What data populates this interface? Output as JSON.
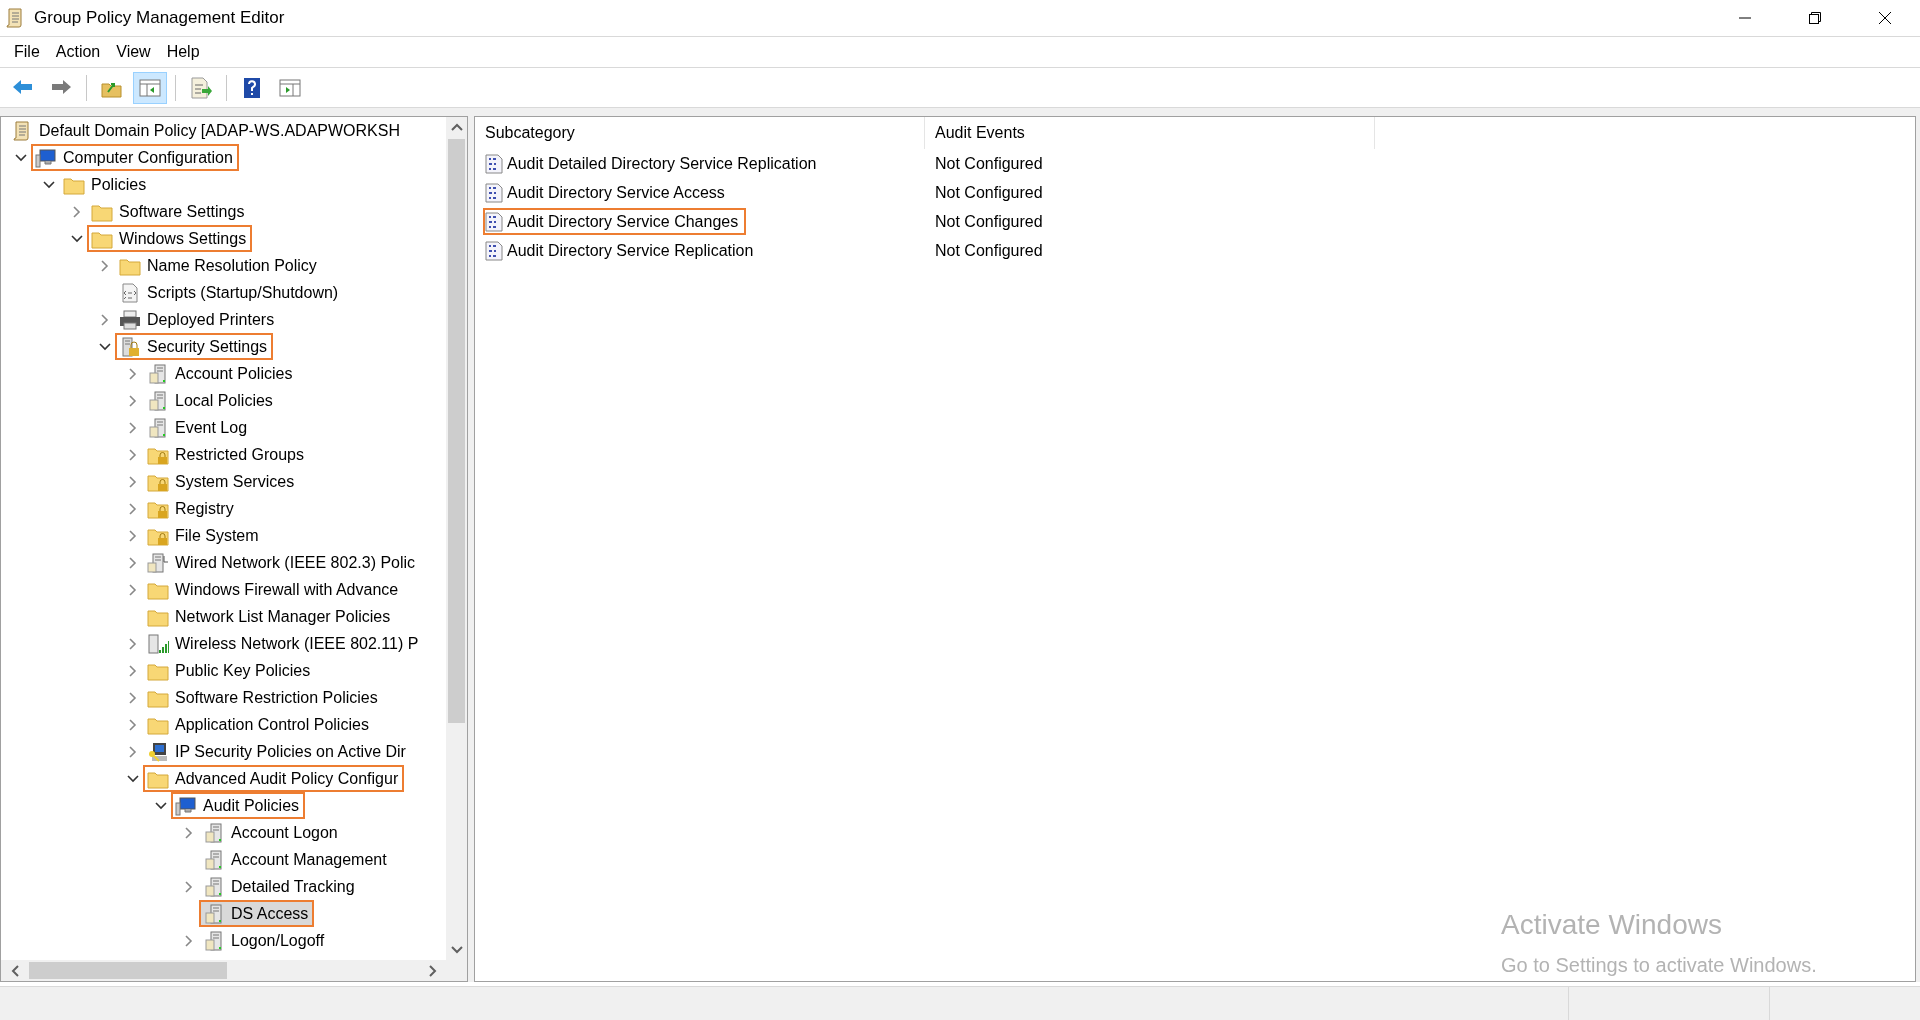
{
  "window": {
    "title": "Group Policy Management Editor"
  },
  "menu": [
    "File",
    "Action",
    "View",
    "Help"
  ],
  "toolbar": [
    {
      "kind": "back"
    },
    {
      "kind": "forward"
    },
    {
      "kind": "sep"
    },
    {
      "kind": "up"
    },
    {
      "kind": "tree-toggle",
      "selected": true
    },
    {
      "kind": "sep"
    },
    {
      "kind": "export"
    },
    {
      "kind": "sep"
    },
    {
      "kind": "help"
    },
    {
      "kind": "action-pane"
    }
  ],
  "tree": [
    {
      "label": "Default Domain Policy [ADAP-WS.ADAPWORKSH",
      "kind": "scroll",
      "highlighted": false,
      "selected": false,
      "children": [
        {
          "label": "Computer Configuration",
          "kind": "computer",
          "expandable": true,
          "expanded": true,
          "highlighted": true,
          "selected": false,
          "children": [
            {
              "label": "Policies",
              "kind": "folder",
              "expandable": true,
              "expanded": true,
              "highlighted": false,
              "selected": false,
              "children": [
                {
                  "label": "Software Settings",
                  "kind": "folder",
                  "expandable": true,
                  "expanded": false,
                  "highlighted": false,
                  "selected": false
                },
                {
                  "label": "Windows Settings",
                  "kind": "folder",
                  "expandable": true,
                  "expanded": true,
                  "highlighted": true,
                  "selected": false,
                  "children": [
                    {
                      "label": "Name Resolution Policy",
                      "kind": "folder",
                      "expandable": true,
                      "expanded": false,
                      "highlighted": false,
                      "selected": false
                    },
                    {
                      "label": "Scripts (Startup/Shutdown)",
                      "kind": "scripts",
                      "expandable": false,
                      "highlighted": false,
                      "selected": false
                    },
                    {
                      "label": "Deployed Printers",
                      "kind": "printer",
                      "expandable": true,
                      "expanded": false,
                      "highlighted": false,
                      "selected": false
                    },
                    {
                      "label": "Security Settings",
                      "kind": "security",
                      "expandable": true,
                      "expanded": true,
                      "highlighted": true,
                      "selected": false,
                      "children": [
                        {
                          "label": "Account Policies",
                          "kind": "server",
                          "expandable": true,
                          "expanded": false,
                          "highlighted": false,
                          "selected": false
                        },
                        {
                          "label": "Local Policies",
                          "kind": "server",
                          "expandable": true,
                          "expanded": false,
                          "highlighted": false,
                          "selected": false
                        },
                        {
                          "label": "Event Log",
                          "kind": "server",
                          "expandable": true,
                          "expanded": false,
                          "highlighted": false,
                          "selected": false
                        },
                        {
                          "label": "Restricted Groups",
                          "kind": "locked-folder",
                          "expandable": true,
                          "expanded": false,
                          "highlighted": false,
                          "selected": false
                        },
                        {
                          "label": "System Services",
                          "kind": "locked-folder",
                          "expandable": true,
                          "expanded": false,
                          "highlighted": false,
                          "selected": false
                        },
                        {
                          "label": "Registry",
                          "kind": "locked-folder",
                          "expandable": true,
                          "expanded": false,
                          "highlighted": false,
                          "selected": false
                        },
                        {
                          "label": "File System",
                          "kind": "locked-folder",
                          "expandable": true,
                          "expanded": false,
                          "highlighted": false,
                          "selected": false
                        },
                        {
                          "label": "Wired Network (IEEE 802.3) Polic",
                          "kind": "network",
                          "expandable": true,
                          "expanded": false,
                          "highlighted": false,
                          "selected": false
                        },
                        {
                          "label": "Windows Firewall with Advance",
                          "kind": "folder",
                          "expandable": true,
                          "expanded": false,
                          "highlighted": false,
                          "selected": false
                        },
                        {
                          "label": "Network List Manager Policies",
                          "kind": "folder",
                          "expandable": false,
                          "highlighted": false,
                          "selected": false
                        },
                        {
                          "label": "Wireless Network (IEEE 802.11) P",
                          "kind": "wireless",
                          "expandable": true,
                          "expanded": false,
                          "highlighted": false,
                          "selected": false
                        },
                        {
                          "label": "Public Key Policies",
                          "kind": "folder",
                          "expandable": true,
                          "expanded": false,
                          "highlighted": false,
                          "selected": false
                        },
                        {
                          "label": "Software Restriction Policies",
                          "kind": "folder",
                          "expandable": true,
                          "expanded": false,
                          "highlighted": false,
                          "selected": false
                        },
                        {
                          "label": "Application Control Policies",
                          "kind": "folder",
                          "expandable": true,
                          "expanded": false,
                          "highlighted": false,
                          "selected": false
                        },
                        {
                          "label": "IP Security Policies on Active Dir",
                          "kind": "ip-security",
                          "expandable": true,
                          "expanded": false,
                          "highlighted": false,
                          "selected": false
                        },
                        {
                          "label": "Advanced Audit Policy Configur",
                          "kind": "folder",
                          "expandable": true,
                          "expanded": true,
                          "highlighted": true,
                          "selected": false,
                          "children": [
                            {
                              "label": "Audit Policies",
                              "kind": "computer",
                              "expandable": true,
                              "expanded": true,
                              "highlighted": true,
                              "selected": false,
                              "children": [
                                {
                                  "label": "Account Logon",
                                  "kind": "server",
                                  "expandable": true,
                                  "expanded": false,
                                  "highlighted": false,
                                  "selected": false
                                },
                                {
                                  "label": "Account Management",
                                  "kind": "server",
                                  "expandable": false,
                                  "highlighted": false,
                                  "selected": false
                                },
                                {
                                  "label": "Detailed Tracking",
                                  "kind": "server",
                                  "expandable": true,
                                  "expanded": false,
                                  "highlighted": false,
                                  "selected": false
                                },
                                {
                                  "label": "DS Access",
                                  "kind": "server",
                                  "expandable": false,
                                  "highlighted": true,
                                  "selected": true
                                },
                                {
                                  "label": "Logon/Logoff",
                                  "kind": "server",
                                  "expandable": true,
                                  "expanded": false,
                                  "highlighted": false,
                                  "selected": false
                                }
                              ]
                            }
                          ]
                        }
                      ]
                    }
                  ]
                }
              ]
            }
          ]
        }
      ]
    }
  ],
  "table": {
    "columns": [
      "Subcategory",
      "Audit Events"
    ],
    "rows": [
      {
        "cells": [
          "Audit Detailed Directory Service Replication",
          "Not Configured"
        ],
        "highlighted": false
      },
      {
        "cells": [
          "Audit Directory Service Access",
          "Not Configured"
        ],
        "highlighted": false
      },
      {
        "cells": [
          "Audit Directory Service Changes",
          "Not Configured"
        ],
        "highlighted": true
      },
      {
        "cells": [
          "Audit Directory Service Replication",
          "Not Configured"
        ],
        "highlighted": false
      }
    ]
  },
  "activation_notice": {
    "title": "Activate Windows",
    "text": "Go to Settings to activate Windows."
  }
}
